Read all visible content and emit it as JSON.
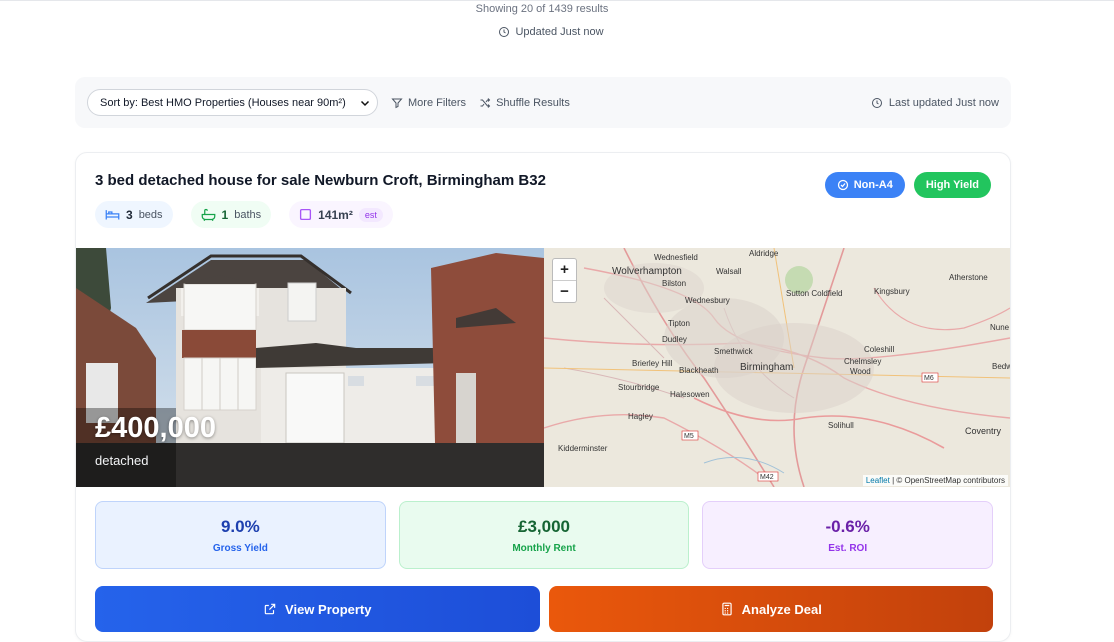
{
  "summary": {
    "results": "Showing 20 of 1439 results",
    "updated": "Updated Just now"
  },
  "toolbar": {
    "sort_label": "Sort by: Best HMO Properties (Houses near 90m²)",
    "more_filters": "More Filters",
    "shuffle": "Shuffle Results",
    "last_updated": "Last updated Just now"
  },
  "listing": {
    "title": "3 bed detached house for sale Newburn Croft, Birmingham B32",
    "badges": [
      "Non-A4",
      "High Yield"
    ],
    "beds": {
      "value": "3",
      "label": "beds"
    },
    "baths": {
      "value": "1",
      "label": "baths"
    },
    "area": {
      "value": "141m²",
      "tag": "est"
    },
    "price": "£400,000",
    "property_type": "detached"
  },
  "map": {
    "zoom_in": "+",
    "zoom_out": "−",
    "labels": [
      "Wednesfield",
      "Aldridge",
      "Wolverhampton",
      "Walsall",
      "Bilston",
      "Wednesbury",
      "Sutton Coldfield",
      "Kingsbury",
      "Atherstone",
      "Tipton",
      "Dudley",
      "Smethwick",
      "Birmingham",
      "Brierley Hill",
      "Blackheath",
      "Coleshill",
      "Chelmsley Wood",
      "Stourbridge",
      "Halesowen",
      "Hagley",
      "Solihull",
      "Kidderminster",
      "Coventry",
      "Nune",
      "Bedw"
    ],
    "roads": [
      "M6",
      "M5",
      "M42"
    ],
    "attribution_leaflet": "Leaflet",
    "attribution_osm": "| © OpenStreetMap contributors"
  },
  "metrics": [
    {
      "value": "9.0%",
      "label": "Gross Yield"
    },
    {
      "value": "£3,000",
      "label": "Monthly Rent"
    },
    {
      "value": "-0.6%",
      "label": "Est. ROI"
    }
  ],
  "actions": {
    "view": "View Property",
    "analyze": "Analyze Deal"
  },
  "colors": {
    "primary_blue": "#3b82f6",
    "success_green": "#22c55e",
    "cta_blue": "#1d4ed8",
    "cta_orange": "#ea580c"
  }
}
